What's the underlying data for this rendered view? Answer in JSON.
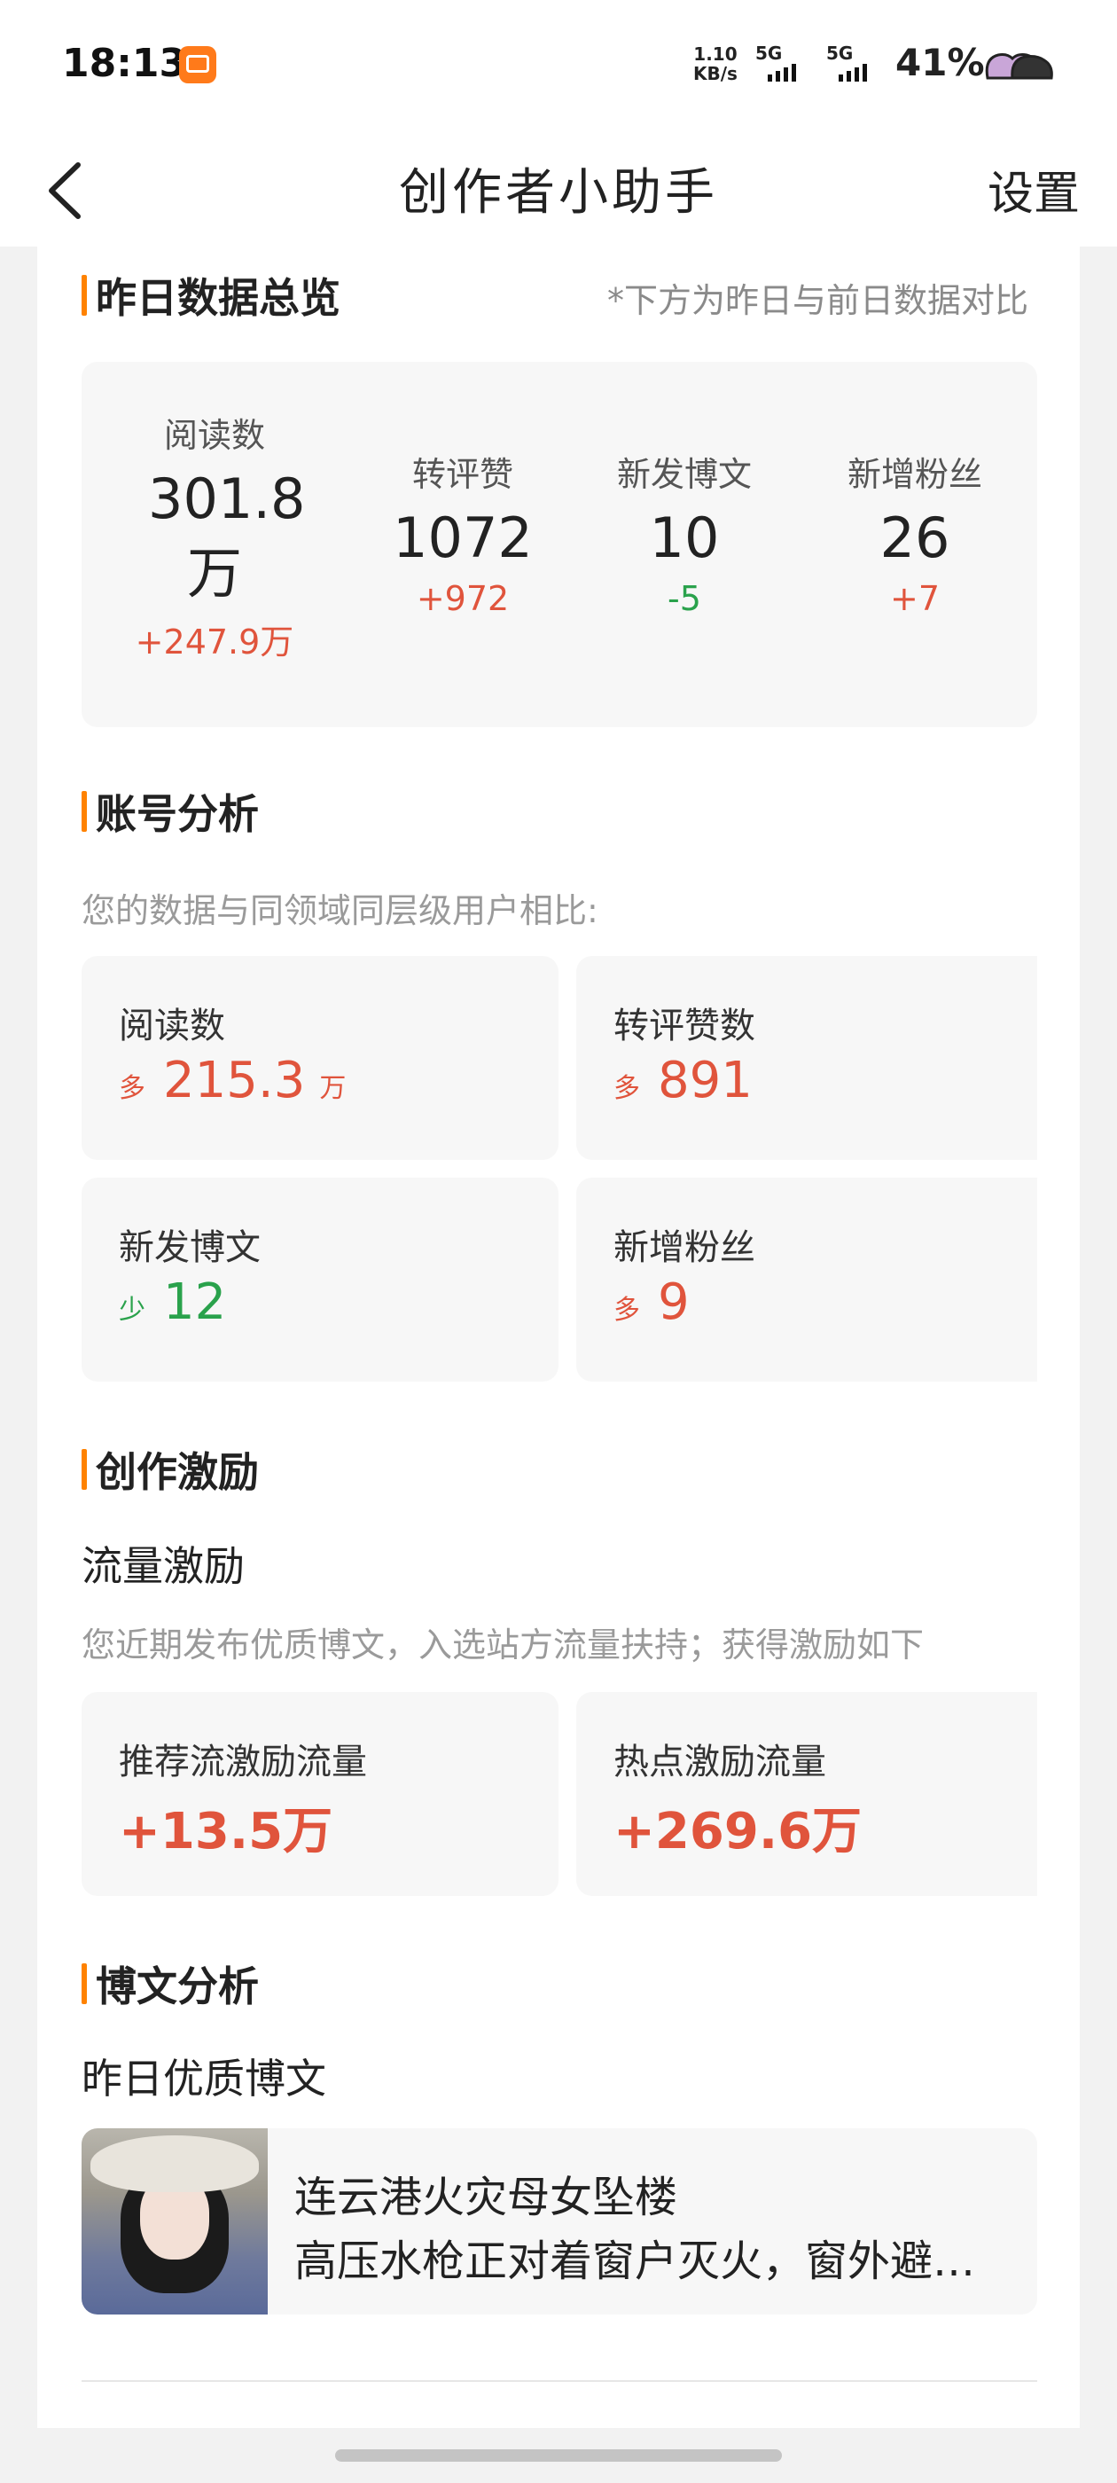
{
  "status_bar": {
    "time": "18:13",
    "net_speed_value": "1.10",
    "net_speed_unit": "KB/s",
    "sim1": "5G",
    "sim2": "5G",
    "battery": "41%"
  },
  "header": {
    "title": "创作者小助手",
    "settings": "设置"
  },
  "overview": {
    "title": "昨日数据总览",
    "note": "*下方为昨日与前日数据对比",
    "items": [
      {
        "label": "阅读数",
        "value": "301.8 万",
        "diff": "+247.9万",
        "trend": "up"
      },
      {
        "label": "转评赞",
        "value": "1072",
        "diff": "+972",
        "trend": "up"
      },
      {
        "label": "新发博文",
        "value": "10",
        "diff": "-5",
        "trend": "down"
      },
      {
        "label": "新增粉丝",
        "value": "26",
        "diff": "+7",
        "trend": "up"
      }
    ]
  },
  "account_analysis": {
    "title": "账号分析",
    "subtitle": "您的数据与同领域同层级用户相比:",
    "items": [
      {
        "label": "阅读数",
        "tag": "多",
        "value": "215.3",
        "unit": "万",
        "trend": "up"
      },
      {
        "label": "转评赞数",
        "tag": "多",
        "value": "891",
        "unit": "",
        "trend": "up"
      },
      {
        "label": "新发博文",
        "tag": "少",
        "value": "12",
        "unit": "",
        "trend": "down"
      },
      {
        "label": "新增粉丝",
        "tag": "多",
        "value": "9",
        "unit": "",
        "trend": "up"
      }
    ]
  },
  "incentive": {
    "title": "创作激励",
    "subtitle": "流量激励",
    "description": "您近期发布优质博文，入选站方流量扶持；获得激励如下",
    "items": [
      {
        "label": "推荐流激励流量",
        "value": "+13.5万"
      },
      {
        "label": "热点激励流量",
        "value": "+269.6万"
      }
    ]
  },
  "post_analysis": {
    "title": "博文分析",
    "subtitle": "昨日优质博文",
    "post": {
      "title": "连云港火灾母女坠楼",
      "excerpt": "高压水枪正对着窗户灭火，窗外避…"
    }
  },
  "colors": {
    "accent": "#ff8200",
    "up": "#e0543c",
    "down": "#2aa24c"
  }
}
